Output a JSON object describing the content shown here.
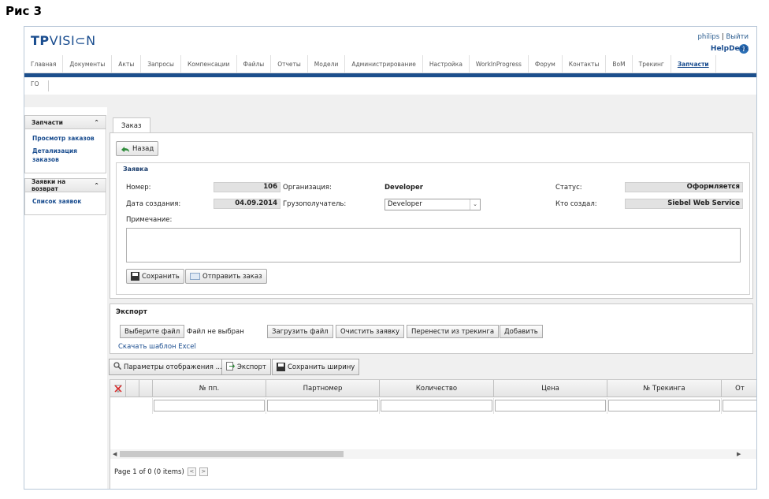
{
  "caption": "Рис 3",
  "brand": {
    "tp": "TP",
    "vision": "VISI⊂N"
  },
  "user": {
    "name": "philips",
    "separator": "|",
    "logout": "Выйти",
    "helpdesk": "HelpDesk"
  },
  "nav": [
    "Главная",
    "Документы",
    "Акты",
    "Запросы",
    "Компенсации",
    "Файлы",
    "Отчеты",
    "Модели",
    "Администрирование",
    "Настройка",
    "WorkInProgress",
    "Форум",
    "Контакты",
    "BoM",
    "Трекинг",
    "Запчасти"
  ],
  "subnav": "ГО",
  "sidebar": {
    "panel1": {
      "title": "Запчасти",
      "links": [
        "Просмотр заказов",
        "Детализация заказов"
      ]
    },
    "panel2": {
      "title": "Заявки на возврат",
      "links": [
        "Список заявок"
      ]
    }
  },
  "tab": "Заказ",
  "order": {
    "back_label": "Назад",
    "section_title": "Заявка",
    "number_label": "Номер:",
    "number_value": "106",
    "created_label": "Дата создания:",
    "created_value": "04.09.2014",
    "org_label": "Организация:",
    "org_value": "Developer",
    "consignee_label": "Грузополучатель:",
    "consignee_value": "Developer",
    "status_label": "Статус:",
    "status_value": "Оформляется",
    "creator_label": "Кто создал:",
    "creator_value": "Siebel Web Service",
    "note_label": "Примечание:",
    "save_label": "Сохранить",
    "send_label": "Отправить заказ"
  },
  "export": {
    "title": "Экспорт",
    "choose_file": "Выберите файл",
    "no_file": "Файл не выбран",
    "upload": "Загрузить файл",
    "clear": "Очистить заявку",
    "transfer": "Перенести из трекинга",
    "add": "Добавить",
    "template_link": "Скачать шаблон Excel"
  },
  "grid_toolbar": {
    "params": "Параметры отображения ...",
    "export": "Экспорт",
    "save_width": "Сохранить ширину"
  },
  "grid": {
    "columns": [
      "№ пп.",
      "Партномер",
      "Количество",
      "Цена",
      "№ Трекинга",
      "От"
    ],
    "pager": "Page 1 of 0 (0 items)"
  }
}
